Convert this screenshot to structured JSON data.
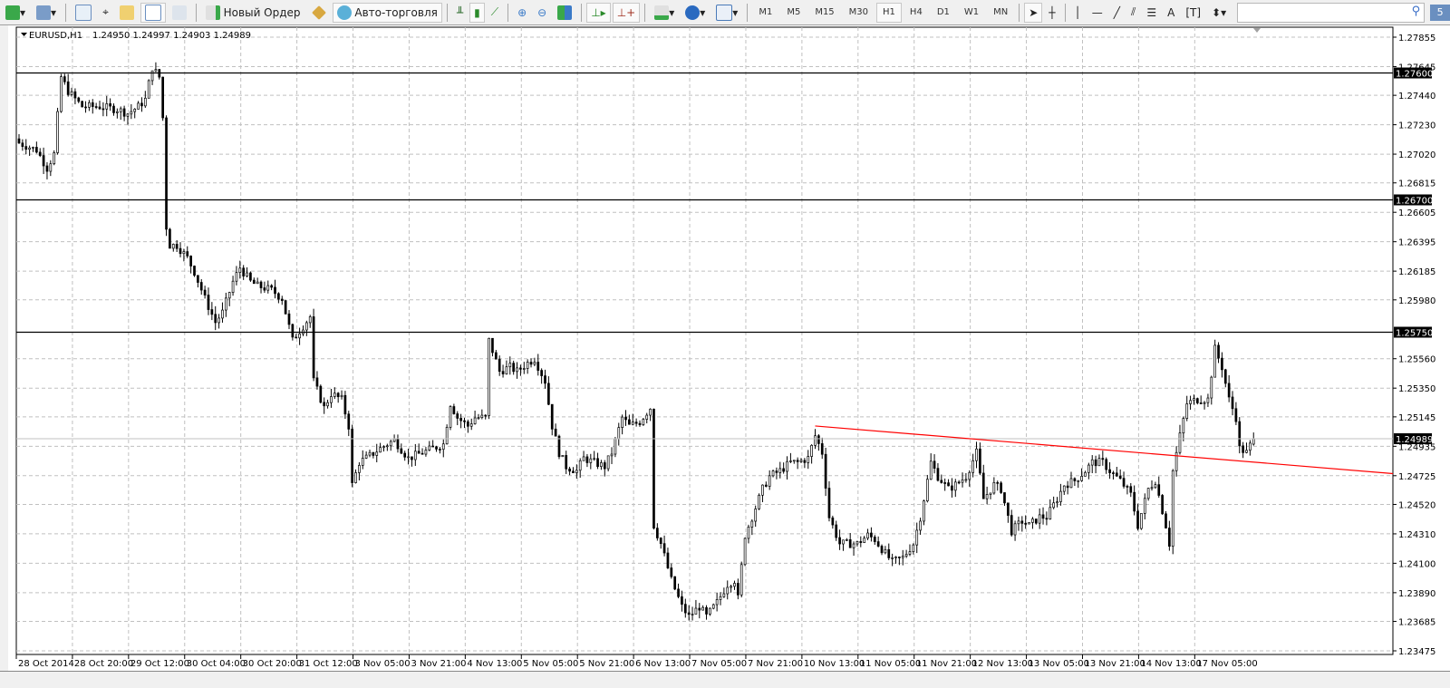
{
  "toolbar": {
    "new_order": "Новый Ордер",
    "auto_trading": "Авто-торговля",
    "timeframes": [
      "M1",
      "M5",
      "M15",
      "M30",
      "H1",
      "H4",
      "D1",
      "W1",
      "MN"
    ],
    "active_timeframe": "H1",
    "search_placeholder": "",
    "notifications": "5",
    "icons": [
      "new-chart-icon",
      "profiles-icon",
      "market-watch-icon",
      "navigator-crosshair-icon",
      "favorites-icon",
      "data-window-icon",
      "strategy-tester-icon",
      "new-order-icon",
      "metaeditor-icon",
      "auto-trading-icon",
      "bar-chart-icon",
      "candlesticks-icon",
      "line-chart-icon",
      "zoom-in-icon",
      "zoom-out-icon",
      "tile-windows-icon",
      "chart-shift-icon",
      "autoscroll-icon",
      "indicators-icon",
      "periods-icon",
      "templates-icon",
      "cursor-icon",
      "crosshair-icon",
      "vertical-line-icon",
      "horizontal-line-icon",
      "trendline-icon",
      "equidistant-channel-icon",
      "fibonacci-icon",
      "text-icon",
      "text-label-icon",
      "arrows-icon"
    ]
  },
  "chart_data": {
    "type": "candlestick",
    "title": "EURUSD,H1",
    "ohlc": "1.24950 1.24997 1.24903 1.24989",
    "ylim": [
      1.23475,
      1.27855
    ],
    "y_ticks": [
      "1.27855",
      "1.27645",
      "1.27440",
      "1.27230",
      "1.27020",
      "1.26815",
      "1.26605",
      "1.26395",
      "1.26185",
      "1.25980",
      "1.25560",
      "1.25350",
      "1.25145",
      "1.24935",
      "1.24725",
      "1.24520",
      "1.24310",
      "1.24100",
      "1.23890",
      "1.23685",
      "1.23475"
    ],
    "x_ticks": [
      "28 Oct 2014",
      "28 Oct 20:00",
      "29 Oct 12:00",
      "30 Oct 04:00",
      "30 Oct 20:00",
      "31 Oct 12:00",
      "3 Nov 05:00",
      "3 Nov 21:00",
      "4 Nov 13:00",
      "5 Nov 05:00",
      "5 Nov 21:00",
      "6 Nov 13:00",
      "7 Nov 05:00",
      "7 Nov 21:00",
      "10 Nov 13:00",
      "11 Nov 05:00",
      "11 Nov 21:00",
      "12 Nov 13:00",
      "13 Nov 05:00",
      "13 Nov 21:00",
      "14 Nov 13:00",
      "17 Nov 05:00"
    ],
    "bars_per_tick": 16,
    "horizontal_lines": [
      {
        "price": "1.27600",
        "color": "#000000"
      },
      {
        "price": "1.26700",
        "color": "#000000"
      },
      {
        "price": "1.25750",
        "color": "#000000"
      }
    ],
    "current_price": "1.24989",
    "trendline": {
      "color": "#ff0000",
      "points": [
        [
          227,
          1.2508
        ],
        [
          392,
          1.2474
        ]
      ]
    },
    "close_path": [
      [
        0,
        1.271
      ],
      [
        5,
        1.2705
      ],
      [
        8,
        1.2692
      ],
      [
        10,
        1.2702
      ],
      [
        12,
        1.2757
      ],
      [
        14,
        1.2747
      ],
      [
        18,
        1.2736
      ],
      [
        23,
        1.2736
      ],
      [
        28,
        1.2734
      ],
      [
        31,
        1.2731
      ],
      [
        34,
        1.2736
      ],
      [
        36,
        1.2741
      ],
      [
        38,
        1.2764
      ],
      [
        40,
        1.2757
      ],
      [
        41,
        1.2728
      ],
      [
        42,
        1.265
      ],
      [
        43,
        1.2637
      ],
      [
        45,
        1.2637
      ],
      [
        48,
        1.2628
      ],
      [
        50,
        1.2618
      ],
      [
        53,
        1.2599
      ],
      [
        56,
        1.2582
      ],
      [
        58,
        1.2589
      ],
      [
        61,
        1.2611
      ],
      [
        63,
        1.2621
      ],
      [
        66,
        1.2611
      ],
      [
        68,
        1.2608
      ],
      [
        72,
        1.2605
      ],
      [
        75,
        1.2599
      ],
      [
        78,
        1.2569
      ],
      [
        80,
        1.2576
      ],
      [
        83,
        1.2586
      ],
      [
        84,
        1.254
      ],
      [
        87,
        1.2521
      ],
      [
        89,
        1.2531
      ],
      [
        92,
        1.2527
      ],
      [
        94,
        1.2508
      ],
      [
        95,
        1.2466
      ],
      [
        97,
        1.2482
      ],
      [
        99,
        1.2485
      ],
      [
        103,
        1.2492
      ],
      [
        107,
        1.2498
      ],
      [
        111,
        1.2485
      ],
      [
        115,
        1.2489
      ],
      [
        118,
        1.2492
      ],
      [
        121,
        1.2495
      ],
      [
        123,
        1.2524
      ],
      [
        125,
        1.2514
      ],
      [
        128,
        1.2508
      ],
      [
        130,
        1.2514
      ],
      [
        133,
        1.2514
      ],
      [
        134,
        1.2569
      ],
      [
        137,
        1.2547
      ],
      [
        140,
        1.255
      ],
      [
        142,
        1.2547
      ],
      [
        145,
        1.2553
      ],
      [
        147,
        1.2556
      ],
      [
        150,
        1.254
      ],
      [
        152,
        1.2508
      ],
      [
        154,
        1.2489
      ],
      [
        156,
        1.2479
      ],
      [
        159,
        1.2476
      ],
      [
        161,
        1.2485
      ],
      [
        164,
        1.2482
      ],
      [
        167,
        1.2479
      ],
      [
        169,
        1.2489
      ],
      [
        172,
        1.2514
      ],
      [
        174,
        1.2508
      ],
      [
        177,
        1.2511
      ],
      [
        180,
        1.2521
      ],
      [
        181,
        1.2437
      ],
      [
        183,
        1.2424
      ],
      [
        186,
        1.2398
      ],
      [
        189,
        1.2379
      ],
      [
        191,
        1.2372
      ],
      [
        194,
        1.2379
      ],
      [
        196,
        1.2372
      ],
      [
        199,
        1.2382
      ],
      [
        202,
        1.2395
      ],
      [
        204,
        1.2398
      ],
      [
        205,
        1.2385
      ],
      [
        207,
        1.243
      ],
      [
        209,
        1.2443
      ],
      [
        212,
        1.2463
      ],
      [
        214,
        1.2472
      ],
      [
        217,
        1.2476
      ],
      [
        220,
        1.2482
      ],
      [
        222,
        1.2482
      ],
      [
        225,
        1.2485
      ],
      [
        227,
        1.2501
      ],
      [
        229,
        1.2489
      ],
      [
        231,
        1.2443
      ],
      [
        234,
        1.2424
      ],
      [
        236,
        1.2424
      ],
      [
        239,
        1.2424
      ],
      [
        242,
        1.243
      ],
      [
        244,
        1.2427
      ],
      [
        247,
        1.2417
      ],
      [
        249,
        1.2411
      ],
      [
        252,
        1.2414
      ],
      [
        255,
        1.2424
      ],
      [
        257,
        1.2443
      ],
      [
        260,
        1.2482
      ],
      [
        262,
        1.2472
      ],
      [
        265,
        1.2463
      ],
      [
        267,
        1.2466
      ],
      [
        270,
        1.2472
      ],
      [
        273,
        1.2489
      ],
      [
        275,
        1.2456
      ],
      [
        278,
        1.2466
      ],
      [
        280,
        1.2463
      ],
      [
        283,
        1.2433
      ],
      [
        286,
        1.244
      ],
      [
        288,
        1.2437
      ],
      [
        291,
        1.2443
      ],
      [
        293,
        1.2443
      ],
      [
        296,
        1.2456
      ],
      [
        298,
        1.2466
      ],
      [
        301,
        1.2469
      ],
      [
        304,
        1.2476
      ],
      [
        306,
        1.2482
      ],
      [
        309,
        1.2482
      ],
      [
        311,
        1.2476
      ],
      [
        314,
        1.2469
      ],
      [
        317,
        1.2459
      ],
      [
        319,
        1.2437
      ],
      [
        322,
        1.2463
      ],
      [
        324,
        1.2469
      ],
      [
        327,
        1.2437
      ],
      [
        328,
        1.2424
      ],
      [
        329,
        1.2476
      ],
      [
        331,
        1.2501
      ],
      [
        333,
        1.2524
      ],
      [
        336,
        1.2527
      ],
      [
        339,
        1.2527
      ],
      [
        341,
        1.2563
      ],
      [
        343,
        1.255
      ],
      [
        345,
        1.2527
      ],
      [
        347,
        1.2514
      ],
      [
        348,
        1.2492
      ],
      [
        350,
        1.2489
      ],
      [
        352,
        1.24989
      ]
    ]
  }
}
